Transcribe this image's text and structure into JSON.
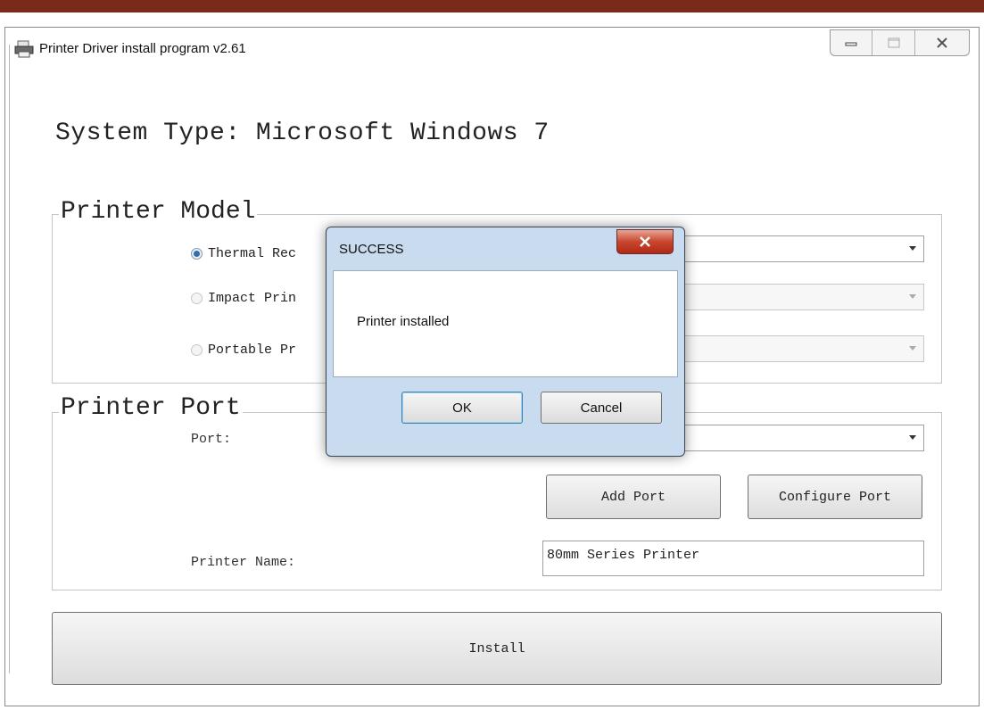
{
  "window": {
    "title": "Printer Driver install program v2.61"
  },
  "system_type": "System Type: Microsoft Windows 7",
  "printer_model": {
    "title": "Printer Model",
    "options": [
      {
        "label": "Thermal Rec",
        "selected": true
      },
      {
        "label": "Impact Prin",
        "selected": false
      },
      {
        "label": "Portable Pr",
        "selected": false
      }
    ]
  },
  "printer_port": {
    "title": "Printer Port",
    "port_label": "Port:",
    "add_port": "Add Port",
    "configure_port": "Configure Port",
    "printer_name_label": "Printer Name:",
    "printer_name_value": "80mm Series Printer"
  },
  "install_button": "Install",
  "dialog": {
    "title": "SUCCESS",
    "message": "Printer installed",
    "ok": "OK",
    "cancel": "Cancel"
  },
  "colors": {
    "top_band": "#7a2a18",
    "dialog_frame": "#c9dbee",
    "close_red": "#c8452e"
  }
}
